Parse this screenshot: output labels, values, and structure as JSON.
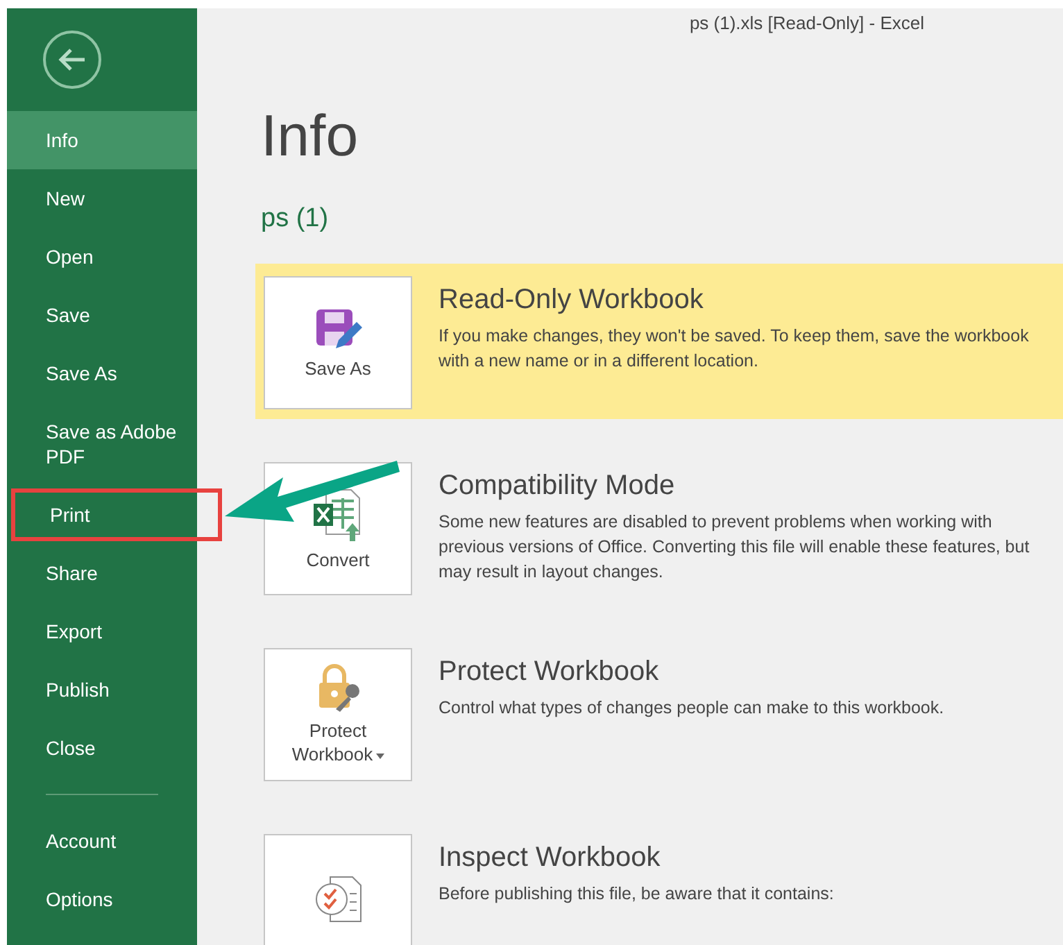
{
  "window": {
    "title": "ps (1).xls  [Read-Only] - Excel"
  },
  "sidebar": {
    "items": [
      {
        "label": "Info",
        "selected": true,
        "highlighted": false
      },
      {
        "label": "New",
        "selected": false,
        "highlighted": false
      },
      {
        "label": "Open",
        "selected": false,
        "highlighted": false
      },
      {
        "label": "Save",
        "selected": false,
        "highlighted": false
      },
      {
        "label": "Save As",
        "selected": false,
        "highlighted": false
      },
      {
        "label": "Save as Adobe PDF",
        "selected": false,
        "highlighted": false
      },
      {
        "label": "Print",
        "selected": false,
        "highlighted": true
      },
      {
        "label": "Share",
        "selected": false,
        "highlighted": false
      },
      {
        "label": "Export",
        "selected": false,
        "highlighted": false
      },
      {
        "label": "Publish",
        "selected": false,
        "highlighted": false
      },
      {
        "label": "Close",
        "selected": false,
        "highlighted": false
      },
      {
        "label": "Account",
        "selected": false,
        "highlighted": false,
        "separator_before": true
      },
      {
        "label": "Options",
        "selected": false,
        "highlighted": false
      }
    ]
  },
  "page": {
    "heading": "Info",
    "file_name": "ps (1)"
  },
  "sections": [
    {
      "kind": "save",
      "button": "Save As",
      "has_menu": false,
      "warning": true,
      "title": "Read-Only Workbook",
      "description": "If you make changes, they won't be saved. To keep them, save the workbook with a new name or in a different location."
    },
    {
      "kind": "convert",
      "button": "Convert",
      "has_menu": false,
      "warning": false,
      "title": "Compatibility Mode",
      "description": "Some new features are disabled to prevent problems when working with previous versions of Office. Converting this file will enable these features, but may result in layout changes."
    },
    {
      "kind": "protect",
      "button": "Protect Workbook",
      "has_menu": true,
      "warning": false,
      "title": "Protect Workbook",
      "description": "Control what types of changes people can make to this workbook."
    },
    {
      "kind": "inspect",
      "warning": false,
      "title": "Inspect Workbook",
      "description": "Before publishing this file, be aware that it contains:"
    }
  ]
}
